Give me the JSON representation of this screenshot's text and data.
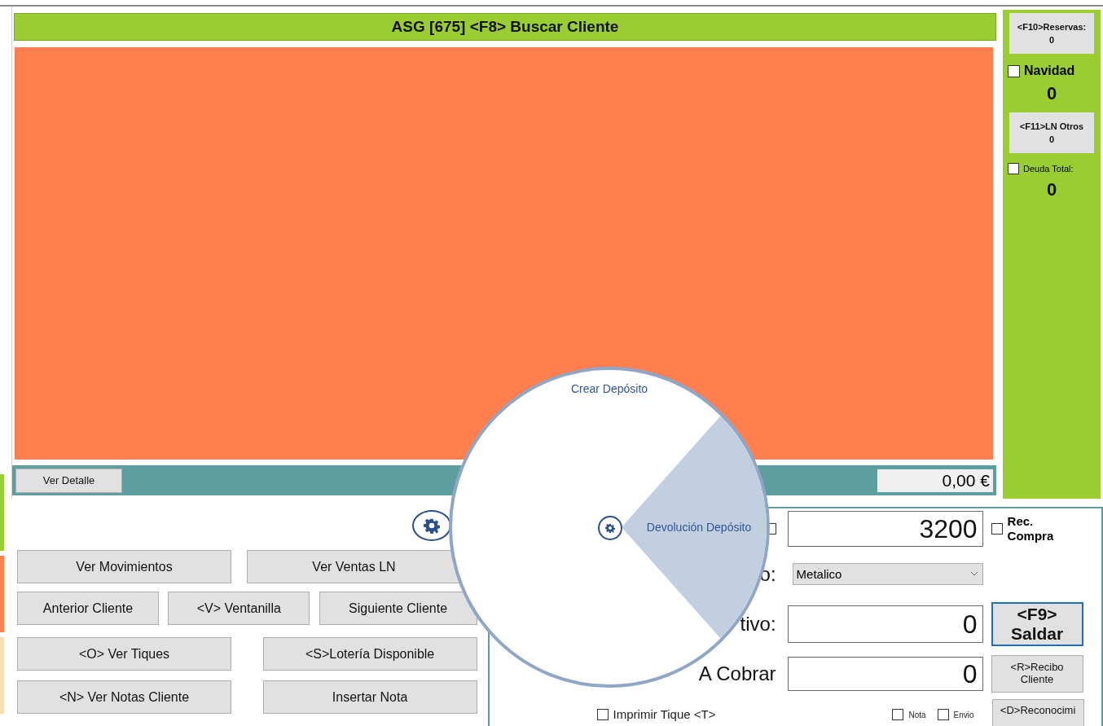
{
  "title": "ASG [675] <F8> Buscar Cliente",
  "detail_button": "Ver Detalle",
  "total": "0,00 €",
  "button_rows": [
    {
      "buttons": [
        "Ver Movimientos",
        "Ver Ventas LN"
      ]
    },
    {
      "buttons": [
        "Anterior Cliente",
        "<V> Ventanilla",
        "Siguiente Cliente"
      ]
    },
    {
      "buttons": [
        "<O> Ver Tiques",
        "<S>Lotería Disponible"
      ]
    },
    {
      "buttons": [
        "<N> Ver Notas Cliente",
        "Insertar Nota"
      ]
    }
  ],
  "payment": {
    "amount_checked": false,
    "amount": "3200",
    "rec_compra": {
      "label": "Rec. Compra",
      "checked": false
    },
    "method_label": "o:",
    "method": "Metalico",
    "cash_label": "tivo:",
    "cash": "0",
    "charge_label": "A Cobrar",
    "charge": "0",
    "print": {
      "label": "Imprimir Tique <T>",
      "checked": false
    },
    "nota": {
      "label": "Nota",
      "checked": false
    },
    "envio": {
      "label": "Envio",
      "checked": false
    }
  },
  "actions": [
    {
      "label": "<F9> Saldar",
      "kind": "primary"
    },
    {
      "label": "<R>Recibo Cliente",
      "kind": "normal"
    },
    {
      "label": "<D>Reconocimi",
      "kind": "normal"
    }
  ],
  "sidebar": {
    "reservas": {
      "label": "<F10>Reservas:",
      "count": "0"
    },
    "navidad": {
      "label": "Navidad",
      "checked": false,
      "value": "0"
    },
    "ln_otros": {
      "label": "<F11>LN Otros",
      "count": "0"
    },
    "deuda": {
      "label": "Deuda Total:",
      "checked": false,
      "value": "0"
    }
  },
  "radial_menu": {
    "items": [
      {
        "label": "Crear Depósito",
        "selected": false
      },
      {
        "label": "Devolución Depósito",
        "selected": true
      }
    ]
  }
}
